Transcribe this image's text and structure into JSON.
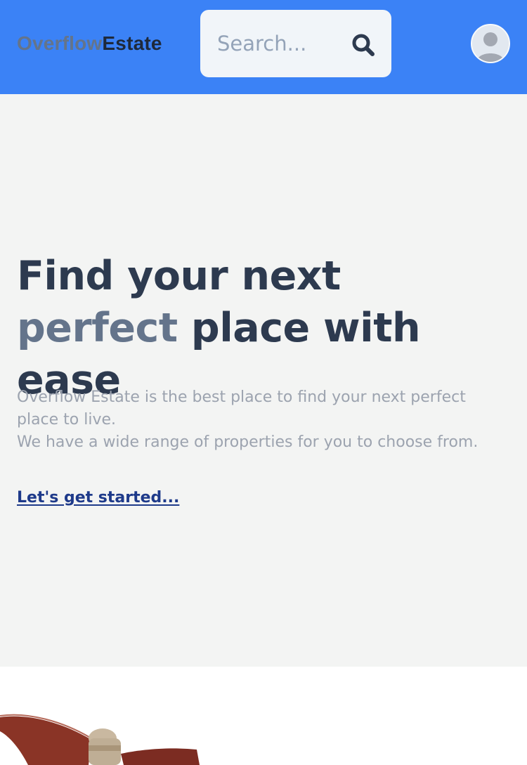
{
  "header": {
    "logo_part1": "Overflow",
    "logo_part2": "Estate",
    "search_placeholder": "Search..."
  },
  "hero": {
    "title_part1": "Find your next ",
    "title_accent": "perfect",
    "title_part2": " place with ease",
    "description_line1": "Overflow Estate is the best place to find your next perfect place to live.",
    "description_line2": "We have a wide range of properties for you to choose from.",
    "cta_label": "Let's get started..."
  },
  "icons": {
    "search": "search-icon",
    "avatar": "user-avatar-icon",
    "image": "ceiling-fan-image"
  },
  "colors": {
    "header_bg": "#3b82f6",
    "hero_bg": "#f3f4f3",
    "title": "#2d3a4f",
    "accent": "#64748b",
    "link": "#1e3a8a",
    "muted": "#9ca3af"
  }
}
